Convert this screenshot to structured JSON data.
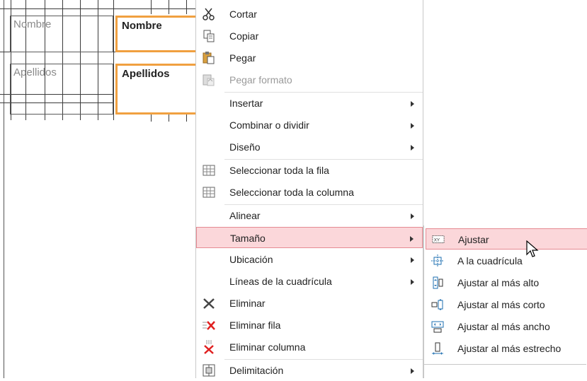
{
  "form": {
    "fields": [
      {
        "label": "Nombre",
        "value": "Nombre"
      },
      {
        "label": "Apellidos",
        "value": "Apellidos"
      }
    ]
  },
  "context_menu": {
    "items": [
      {
        "label": "Cortar",
        "icon": "scissors-icon",
        "enabled": true
      },
      {
        "label": "Copiar",
        "icon": "copy-icon",
        "enabled": true
      },
      {
        "label": "Pegar",
        "icon": "paste-icon",
        "enabled": true
      },
      {
        "label": "Pegar formato",
        "icon": "paste-format-icon",
        "enabled": false
      },
      {
        "label": "Insertar",
        "submenu": true
      },
      {
        "label": "Combinar o dividir",
        "submenu": true
      },
      {
        "label": "Diseño",
        "submenu": true
      },
      {
        "label": "Seleccionar toda la fila",
        "icon": "select-row-icon"
      },
      {
        "label": "Seleccionar toda la columna",
        "icon": "select-column-icon"
      },
      {
        "label": "Alinear",
        "submenu": true
      },
      {
        "label": "Tamaño",
        "submenu": true,
        "highlighted": true
      },
      {
        "label": "Ubicación",
        "submenu": true
      },
      {
        "label": "Líneas de la cuadrícula",
        "submenu": true
      },
      {
        "label": "Eliminar",
        "icon": "delete-x-icon"
      },
      {
        "label": "Eliminar fila",
        "icon": "delete-row-icon"
      },
      {
        "label": "Eliminar columna",
        "icon": "delete-column-icon"
      },
      {
        "label": "Delimitación",
        "icon": "anchoring-icon",
        "submenu": true
      }
    ]
  },
  "size_submenu": {
    "items": [
      {
        "label": "Ajustar",
        "icon": "fit-size-icon",
        "highlighted": true
      },
      {
        "label": "A la cuadrícula",
        "icon": "to-grid-icon"
      },
      {
        "label": "Ajustar al más alto",
        "icon": "to-tallest-icon"
      },
      {
        "label": "Ajustar al más corto",
        "icon": "to-shortest-icon"
      },
      {
        "label": "Ajustar al más ancho",
        "icon": "to-widest-icon"
      },
      {
        "label": "Ajustar al más estrecho",
        "icon": "to-narrowest-icon"
      }
    ]
  },
  "colors": {
    "highlight_bg": "#fbd7da",
    "highlight_border": "#e58a92",
    "field_border": "#f0a040",
    "delete_red": "#e02020"
  }
}
